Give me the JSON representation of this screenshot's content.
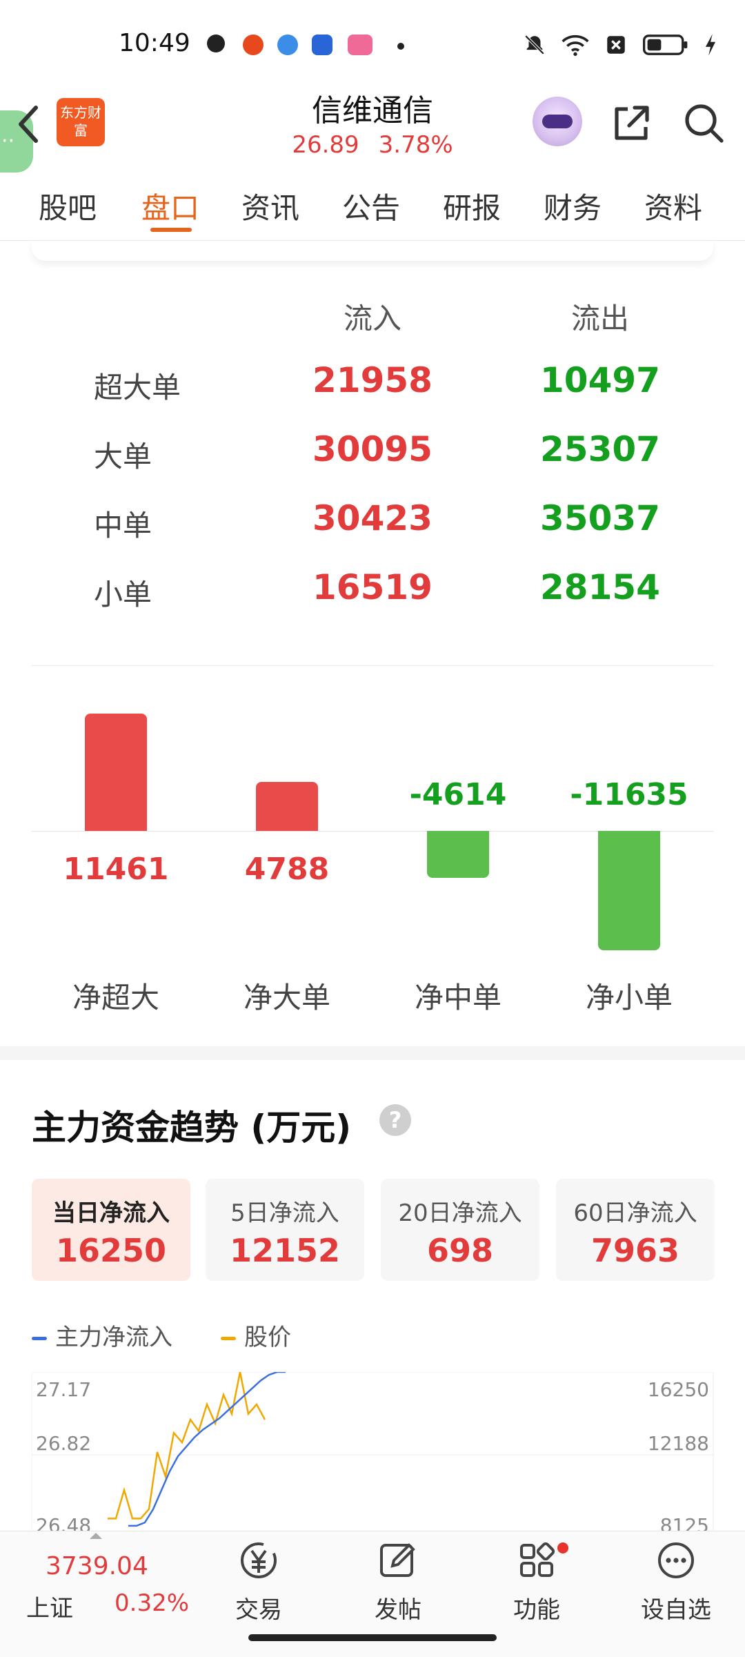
{
  "status_bar": {
    "time": "10:49"
  },
  "header": {
    "logo_text": "东方财富",
    "stock_name": "信维通信",
    "price": "26.89",
    "change_pct": "3.78%"
  },
  "tabs": [
    {
      "label": "股吧"
    },
    {
      "label": "盘口"
    },
    {
      "label": "资讯"
    },
    {
      "label": "公告"
    },
    {
      "label": "研报"
    },
    {
      "label": "财务"
    },
    {
      "label": "资料"
    }
  ],
  "flow_table": {
    "col_in": "流入",
    "col_out": "流出",
    "rows": [
      {
        "label": "超大单",
        "in": "21958",
        "out": "10497"
      },
      {
        "label": "大单",
        "in": "30095",
        "out": "25307"
      },
      {
        "label": "中单",
        "in": "30423",
        "out": "35037"
      },
      {
        "label": "小单",
        "in": "16519",
        "out": "28154"
      }
    ]
  },
  "chart_data": {
    "type": "bar",
    "categories": [
      "净超大",
      "净大单",
      "净中单",
      "净小单"
    ],
    "values": [
      11461,
      4788,
      -4614,
      -11635
    ],
    "value_labels": [
      "11461",
      "4788",
      "-4614",
      "-11635"
    ],
    "positive_color": "#e94a4a",
    "negative_color": "#5cbf4c"
  },
  "trend": {
    "title": "主力资金趋势 (万元)",
    "periods": [
      {
        "label": "当日净流入",
        "value": "16250"
      },
      {
        "label": "5日净流入",
        "value": "12152"
      },
      {
        "label": "20日净流入",
        "value": "698"
      },
      {
        "label": "60日净流入",
        "value": "7963"
      }
    ],
    "legend": [
      {
        "label": "主力净流入",
        "color": "#3b6fe0"
      },
      {
        "label": "股价",
        "color": "#f0a800"
      }
    ],
    "left_axis": [
      "27.17",
      "26.82",
      "26.48"
    ],
    "right_axis": [
      "16250",
      "12188",
      "8125"
    ],
    "price_series": [
      26.4,
      26.4,
      26.55,
      26.4,
      26.4,
      26.45,
      26.75,
      26.62,
      26.85,
      26.8,
      26.92,
      26.86,
      27.0,
      26.9,
      27.05,
      26.95,
      27.17,
      26.95,
      27.0,
      26.92
    ],
    "inflow_series": [
      8125,
      8125,
      8300,
      9000,
      10000,
      11000,
      11800,
      12300,
      12800,
      13200,
      13500,
      13800,
      14200,
      14600,
      15000,
      15400,
      15800,
      16100,
      16250,
      16250
    ]
  },
  "bottom_nav": {
    "index_name": "上证",
    "index_value": "3739.04",
    "index_change": "0.32%",
    "items": [
      {
        "label": "交易"
      },
      {
        "label": "发帖"
      },
      {
        "label": "功能"
      },
      {
        "label": "设自选"
      }
    ]
  }
}
